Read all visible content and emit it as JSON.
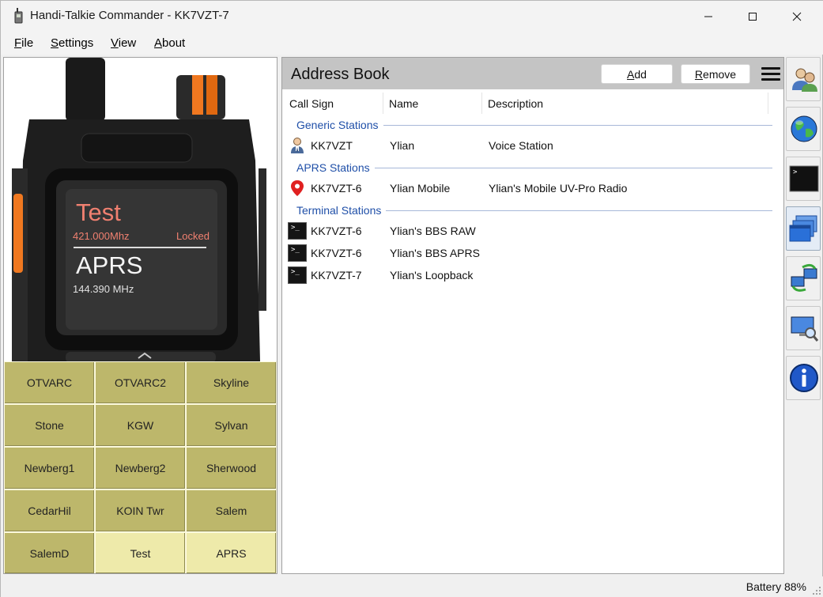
{
  "window": {
    "title": "Handi-Talkie Commander - KK7VZT-7"
  },
  "menu": [
    {
      "key": "F",
      "rest": "ile"
    },
    {
      "key": "S",
      "rest": "ettings"
    },
    {
      "key": "V",
      "rest": "iew"
    },
    {
      "key": "A",
      "rest": "bout"
    }
  ],
  "radio": {
    "channel_a_name": "Test",
    "channel_a_freq": "421.000Mhz",
    "channel_a_status": "Locked",
    "channel_b_name": "APRS",
    "channel_b_freq": "144.390 MHz"
  },
  "channels": [
    {
      "label": "OTVARC",
      "style": "dark"
    },
    {
      "label": "OTVARC2",
      "style": "dark"
    },
    {
      "label": "Skyline",
      "style": "dark"
    },
    {
      "label": "Stone",
      "style": "dark"
    },
    {
      "label": "KGW",
      "style": "dark"
    },
    {
      "label": "Sylvan",
      "style": "dark"
    },
    {
      "label": "Newberg1",
      "style": "dark"
    },
    {
      "label": "Newberg2",
      "style": "dark"
    },
    {
      "label": "Sherwood",
      "style": "dark"
    },
    {
      "label": "CedarHil",
      "style": "dark"
    },
    {
      "label": "KOIN Twr",
      "style": "dark"
    },
    {
      "label": "Salem",
      "style": "dark"
    },
    {
      "label": "SalemD",
      "style": "dark"
    },
    {
      "label": "Test",
      "style": "light"
    },
    {
      "label": "APRS",
      "style": "light"
    }
  ],
  "address_book": {
    "title": "Address Book",
    "add_key": "A",
    "add_rest": "dd",
    "remove_key": "R",
    "remove_rest": "emove",
    "columns": [
      "Call Sign",
      "Name",
      "Description"
    ],
    "groups": [
      {
        "label": "Generic Stations",
        "rows": [
          {
            "icon": "person-icon",
            "callsign": "KK7VZT",
            "name": "Ylian",
            "description": "Voice Station"
          }
        ]
      },
      {
        "label": "APRS Stations",
        "rows": [
          {
            "icon": "map-pin-icon",
            "callsign": "KK7VZT-6",
            "name": "Ylian Mobile",
            "description": "Ylian's Mobile UV-Pro Radio"
          }
        ]
      },
      {
        "label": "Terminal Stations",
        "rows": [
          {
            "icon": "terminal-icon",
            "callsign": "KK7VZT-6",
            "name": "Ylian's BBS RAW",
            "description": ""
          },
          {
            "icon": "terminal-icon",
            "callsign": "KK7VZT-6",
            "name": "Ylian's BBS APRS",
            "description": ""
          },
          {
            "icon": "terminal-icon",
            "callsign": "KK7VZT-7",
            "name": "Ylian's Loopback",
            "description": ""
          }
        ]
      }
    ]
  },
  "toolbar": [
    {
      "icon": "contacts-icon",
      "active": false
    },
    {
      "icon": "globe-icon",
      "active": false
    },
    {
      "icon": "terminal-icon",
      "active": false
    },
    {
      "icon": "windows-icon",
      "active": true
    },
    {
      "icon": "network-sync-icon",
      "active": false
    },
    {
      "icon": "monitor-search-icon",
      "active": false
    },
    {
      "icon": "info-icon",
      "active": false
    }
  ],
  "status": {
    "battery": "Battery 88%"
  },
  "colors": {
    "channel_dark": "#bdb76b",
    "channel_light": "#eeeaaa",
    "group_header": "#1f4fa8",
    "header_bar": "#c4c4c4"
  }
}
